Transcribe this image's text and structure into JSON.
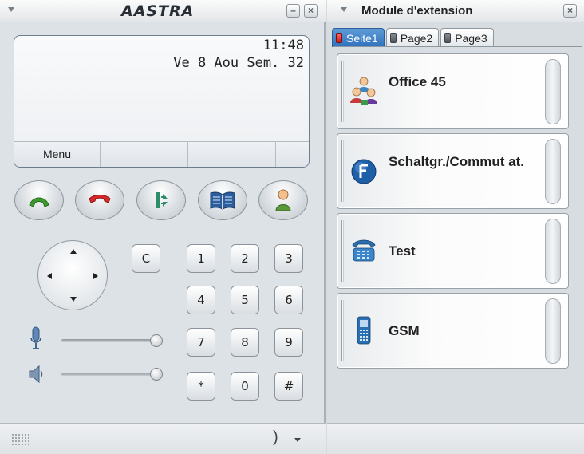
{
  "phone": {
    "brand": "AASTRA",
    "window_controls": {
      "minimize": "–",
      "close": "×"
    },
    "display": {
      "time": "11:48",
      "date": "Ve 8 Aou Sem. 32",
      "softkeys": [
        "Menu",
        "",
        "",
        ""
      ]
    },
    "function_keys": [
      {
        "name": "off-hook-icon",
        "color": "#3e9a2e"
      },
      {
        "name": "hang-up-icon",
        "color": "#d72a2a"
      },
      {
        "name": "transfer-icon",
        "color": "#2f8e6a"
      },
      {
        "name": "phonebook-icon",
        "color": "#2c5e9e"
      },
      {
        "name": "contact-icon",
        "color": "#5a9a3a"
      }
    ],
    "clear_key": "C",
    "keypad": [
      "1",
      "2",
      "3",
      "4",
      "5",
      "6",
      "7",
      "8",
      "9",
      "*",
      "0",
      "#"
    ],
    "status_glyph": ")"
  },
  "module": {
    "title": "Module d'extension",
    "close": "×",
    "tabs": [
      {
        "label": "Seite1",
        "active": true
      },
      {
        "label": "Page2",
        "active": false
      },
      {
        "label": "Page3",
        "active": false
      }
    ],
    "keys": [
      {
        "label": "Office 45",
        "icon": "group-icon"
      },
      {
        "label": "Schaltgr./Commut at.",
        "icon": "forwarding-icon"
      },
      {
        "label": "Test",
        "icon": "desk-phone-icon"
      },
      {
        "label": "GSM",
        "icon": "mobile-phone-icon"
      }
    ]
  }
}
